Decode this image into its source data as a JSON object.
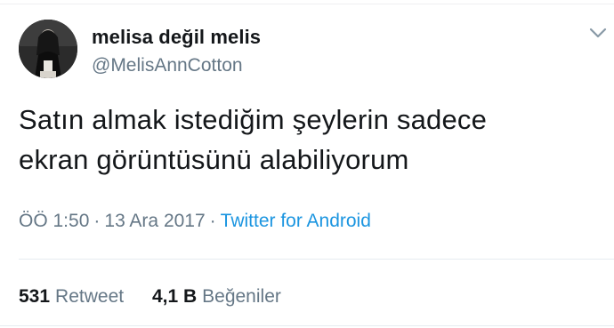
{
  "user": {
    "display_name": "melisa değil melis",
    "handle": "@MelisAnnCotton",
    "avatar_icon": "profile-photo"
  },
  "tweet": {
    "text_line1": "Satın almak istediğim şeylerin sadece",
    "text_line2": "ekran görüntüsünü alabiliyorum"
  },
  "meta": {
    "time": "ÖÖ 1:50",
    "separator1": "·",
    "date": "13 Ara 2017",
    "separator2": "·",
    "source": "Twitter for Android"
  },
  "stats": {
    "retweets_count": "531",
    "retweets_label": "Retweet",
    "likes_count": "4,1 B",
    "likes_label": "Beğeniler"
  },
  "colors": {
    "text": "#14171a",
    "muted": "#657786",
    "link": "#1b95e0",
    "divider": "#e6ecf0"
  },
  "icons": {
    "menu": "chevron-down-icon"
  }
}
